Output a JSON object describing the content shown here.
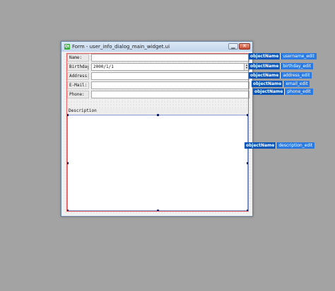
{
  "window": {
    "title": "Form - user_info_dialog_main_widget.ui",
    "icon": "qt-designer-icon",
    "minimize_glyph": "▁",
    "close_glyph": "✕"
  },
  "form": {
    "fields": [
      {
        "label": "Name:",
        "value": ""
      },
      {
        "label": "Birthday:",
        "value": "2000/1/1"
      },
      {
        "label": "Address:",
        "value": ""
      },
      {
        "label": "E-Mail:",
        "value": ""
      },
      {
        "label": "Phone:",
        "value": ""
      }
    ],
    "spin_up": "▲",
    "spin_down": "▼",
    "description_label": "Description",
    "description_value": ""
  },
  "object_tags": {
    "key": "objectName",
    "username": "username_edit",
    "birthday": "birthday_edit",
    "address": "address_edit",
    "email": "email_edit",
    "phone": "phone_edit",
    "description": "description_edit"
  }
}
